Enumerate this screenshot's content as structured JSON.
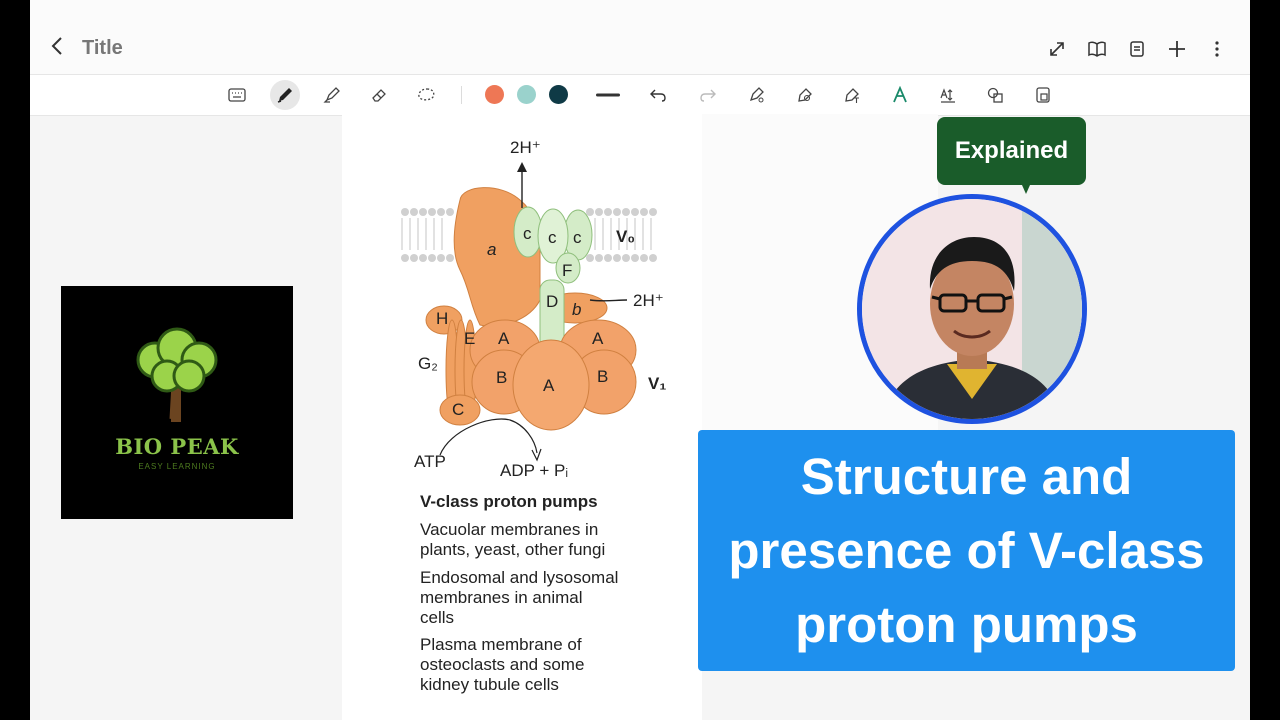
{
  "app": {
    "title": "Title"
  },
  "toolbar": {
    "pen_colors": [
      "#ee7755",
      "#9ad2cc",
      "#0f3a46"
    ]
  },
  "figure": {
    "labels": {
      "top_h": "2H⁺",
      "side_h": "2H⁺",
      "a": "a",
      "c1": "c",
      "c2": "c",
      "c3": "c",
      "v0": "V₀",
      "f": "F",
      "d": "D",
      "b": "b",
      "h": "H",
      "e": "E",
      "a_left": "A",
      "a_right": "A",
      "g2": "G₂",
      "b_left": "B",
      "a_center": "A",
      "b_right": "B",
      "v1": "V₁",
      "c_bottom": "C",
      "atp": "ATP",
      "adp": "ADP + Pᵢ"
    },
    "caption_title": "V-class proton pumps",
    "captions": [
      [
        "Vacuolar membranes in",
        "plants, yeast, other fungi"
      ],
      [
        "Endosomal and lysosomal",
        "membranes in animal",
        "cells"
      ],
      [
        "Plasma membrane of",
        "osteoclasts and some",
        "kidney tubule cells"
      ]
    ]
  },
  "logo": {
    "name": "BIO PEAK",
    "tagline": "EASY LEARNING"
  },
  "bubble": {
    "text": "Explained"
  },
  "banner": {
    "line1": "Structure and",
    "line2": "presence of V-class",
    "line3": "proton pumps"
  }
}
